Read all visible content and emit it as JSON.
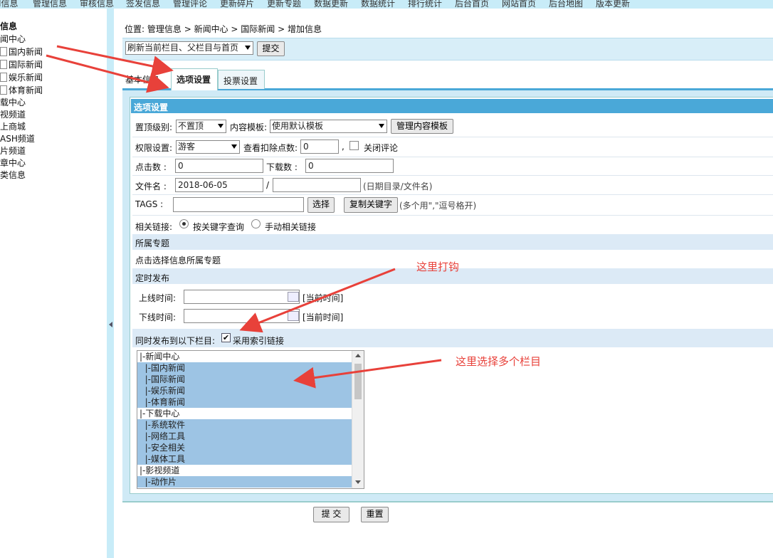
{
  "top_menu": [
    "I信息",
    "管理信息",
    "审核信息",
    "签发信息",
    "管理评论",
    "更新碎片",
    "更新专题",
    "数据更新",
    "数据统计",
    "排行统计",
    "后台首页",
    "网站首页",
    "后台地图",
    "版本更新"
  ],
  "tree": {
    "title": "信息",
    "items": [
      "闻中心",
      "国内新闻",
      "国际新闻",
      "娱乐新闻",
      "体育新闻",
      "载中心",
      "视频道",
      "上商城",
      "ASH频道",
      "片频道",
      "章中心",
      "类信息"
    ]
  },
  "breadcrumb": {
    "prefix": "位置:",
    "items": [
      "管理信息",
      "新闻中心",
      "国际新闻",
      "增加信息"
    ],
    "sep": " > "
  },
  "refresh_select": "刷新当前栏目、父栏目与首页",
  "submit_top": "提交",
  "tabs": [
    "基本信息",
    "选项设置",
    "投票设置"
  ],
  "section_title": "选项设置",
  "form": {
    "top_level_label": "置顶级别:",
    "top_level_value": "不置顶",
    "template_label": "内容模板:",
    "template_value": "使用默认模板",
    "manage_template_btn": "管理内容模板",
    "permission_label": "权限设置:",
    "permission_value": "游客",
    "points_label": "查看扣除点数:",
    "points_value": "0",
    "comma": ",",
    "close_comment": "关闭评论",
    "clicks_label": "点击数  :",
    "clicks_value": "0",
    "downloads_label": "下载数  :",
    "downloads_value": "0",
    "filename_label": "文件名  :",
    "filename_date": "2018-06-05",
    "slash": "/",
    "filename_hint": "(日期目录/文件名)",
    "tags_label": "TAGS   :",
    "choose_btn": "选择",
    "copy_kw_btn": "复制关键字",
    "tags_hint": "(多个用\",\"逗号格开)",
    "related_label": "相关链接:",
    "related_opt1": "按关键字查询",
    "related_opt2": "手动相关链接",
    "special_header": "所属专题",
    "special_link": "点击选择信息所属专题",
    "timed_header": "定时发布",
    "online_label": "上线时间:",
    "offline_label": "下线时间:",
    "now_text": "[当前时间]",
    "publish_to_label": "同时发布到以下栏目:",
    "index_link_label": "采用索引链接"
  },
  "column_list": [
    {
      "text": "|-新闻中心",
      "selected": false
    },
    {
      "text": "  |-国内新闻",
      "selected": true
    },
    {
      "text": "  |-国际新闻",
      "selected": true
    },
    {
      "text": "  |-娱乐新闻",
      "selected": true
    },
    {
      "text": "  |-体育新闻",
      "selected": true
    },
    {
      "text": "|-下载中心",
      "selected": false
    },
    {
      "text": "  |-系统软件",
      "selected": true
    },
    {
      "text": "  |-网络工具",
      "selected": true
    },
    {
      "text": "  |-安全相关",
      "selected": true
    },
    {
      "text": "  |-媒体工具",
      "selected": true
    },
    {
      "text": "|-影视频道",
      "selected": false
    },
    {
      "text": "  |-动作片",
      "selected": true
    }
  ],
  "bottom": {
    "submit": "提 交",
    "reset": "重置"
  },
  "annotations": {
    "check_here": "这里打钩",
    "select_multiple": "这里选择多个栏目"
  },
  "colors": {
    "accent_bar": "#4aa8d8",
    "selected": "#9dc4e4",
    "red": "#e8413a",
    "panel": "#cfeaf6"
  }
}
